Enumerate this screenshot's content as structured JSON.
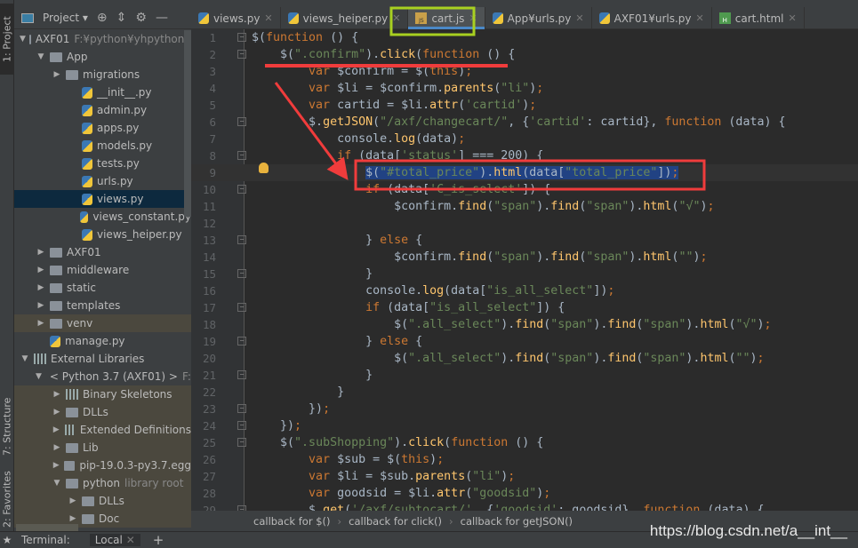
{
  "left_stripe": {
    "project": "1: Project",
    "structure": "7: Structure",
    "favorites": "2: Favorites"
  },
  "sidebar": {
    "title": "Project",
    "tree": [
      {
        "label": "AXF01",
        "extra": "F:¥python¥yhpython¥",
        "depth": 0,
        "arrow": "open",
        "icon": "folder"
      },
      {
        "label": "App",
        "depth": 1,
        "arrow": "open",
        "icon": "folder"
      },
      {
        "label": "migrations",
        "depth": 2,
        "arrow": "closed",
        "icon": "folder"
      },
      {
        "label": "__init__.py",
        "depth": 3,
        "icon": "python-file"
      },
      {
        "label": "admin.py",
        "depth": 3,
        "icon": "python-file"
      },
      {
        "label": "apps.py",
        "depth": 3,
        "icon": "python-file"
      },
      {
        "label": "models.py",
        "depth": 3,
        "icon": "python-file"
      },
      {
        "label": "tests.py",
        "depth": 3,
        "icon": "python-file"
      },
      {
        "label": "urls.py",
        "depth": 3,
        "icon": "python-file"
      },
      {
        "label": "views.py",
        "depth": 3,
        "icon": "python-file",
        "selected": true
      },
      {
        "label": "views_constant.py",
        "depth": 3,
        "icon": "python-file"
      },
      {
        "label": "views_heiper.py",
        "depth": 3,
        "icon": "python-file"
      },
      {
        "label": "AXF01",
        "depth": 1,
        "arrow": "closed",
        "icon": "folder"
      },
      {
        "label": "middleware",
        "depth": 1,
        "arrow": "closed",
        "icon": "folder"
      },
      {
        "label": "static",
        "depth": 1,
        "arrow": "closed",
        "icon": "folder"
      },
      {
        "label": "templates",
        "depth": 1,
        "arrow": "closed",
        "icon": "folder"
      },
      {
        "label": "venv",
        "depth": 1,
        "arrow": "closed",
        "icon": "folder",
        "lib": true
      },
      {
        "label": "manage.py",
        "depth": 1,
        "icon": "python-file"
      },
      {
        "label": "External Libraries",
        "depth": 0,
        "arrow": "open",
        "icon": "library"
      },
      {
        "label": "< Python 3.7 (AXF01) >",
        "extra": "F:¥",
        "depth": 1,
        "arrow": "open",
        "icon": "python-file"
      },
      {
        "label": "Binary Skeletons",
        "depth": 2,
        "arrow": "closed",
        "icon": "library",
        "lib": true
      },
      {
        "label": "DLLs",
        "depth": 2,
        "arrow": "closed",
        "icon": "folder",
        "lib": true
      },
      {
        "label": "Extended Definitions",
        "depth": 2,
        "arrow": "closed",
        "icon": "library",
        "lib": true
      },
      {
        "label": "Lib",
        "depth": 2,
        "arrow": "closed",
        "icon": "folder",
        "lib": true
      },
      {
        "label": "pip-19.0.3-py3.7.egg",
        "depth": 2,
        "arrow": "closed",
        "icon": "folder",
        "lib": true
      },
      {
        "label": "python",
        "extra": "library root",
        "depth": 2,
        "arrow": "open",
        "icon": "folder",
        "lib": true
      },
      {
        "label": "DLLs",
        "depth": 3,
        "arrow": "closed",
        "icon": "folder",
        "lib": true
      },
      {
        "label": "Doc",
        "depth": 3,
        "arrow": "closed",
        "icon": "folder",
        "lib": true
      }
    ]
  },
  "tabs": [
    {
      "label": "views.py",
      "icon": "python-file"
    },
    {
      "label": "views_heiper.py",
      "icon": "python-file"
    },
    {
      "label": "cart.js",
      "icon": "js-file",
      "active": true
    },
    {
      "label": "App¥urls.py",
      "icon": "python-file"
    },
    {
      "label": "AXF01¥urls.py",
      "icon": "python-file"
    },
    {
      "label": "cart.html",
      "icon": "html-file"
    }
  ],
  "editor": {
    "current_line": 9,
    "fold_lines": [
      1,
      2,
      6,
      8,
      10,
      13,
      15,
      17,
      19,
      21,
      23,
      24,
      25,
      29
    ],
    "lines": [
      "$(function () {",
      "    $(\".confirm\").click(function () {",
      "        var $confirm = $(this);",
      "        var $li = $confirm.parents(\"li\");",
      "        var cartid = $li.attr('cartid');",
      "        $.getJSON(\"/axf/changecart/\", {'cartid': cartid}, function (data) {",
      "            console.log(data);",
      "            if (data['status'] === 200) {",
      "                $(\"#total_price\").html(data[\"total_price\"]);",
      "                if (data['C_is_select']) {",
      "                    $confirm.find(\"span\").find(\"span\").html(\"√\");",
      "",
      "                } else {",
      "                    $confirm.find(\"span\").find(\"span\").html(\"\");",
      "                }",
      "                console.log(data[\"is_all_select\"]);",
      "                if (data[\"is_all_select\"]) {",
      "                    $(\".all_select\").find(\"span\").find(\"span\").html(\"√\");",
      "                } else {",
      "                    $(\".all_select\").find(\"span\").find(\"span\").html(\"\");",
      "                }",
      "            }",
      "        });",
      "    });",
      "    $(\".subShopping\").click(function () {",
      "        var $sub = $(this);",
      "        var $li = $sub.parents(\"li\");",
      "        var goodsid = $li.attr(\"goodsid\");",
      "        $.get('/axf/subtocart/', {'goodsid': goodsid}, function (data) {"
    ]
  },
  "breadcrumbs": [
    "callback for $()",
    "callback for click()",
    "callback for getJSON()"
  ],
  "bottom": {
    "terminal": "Terminal:",
    "local": "Local",
    "add": "+"
  },
  "watermark": "https://blog.csdn.net/a__int__",
  "colors": {
    "annotation_red": "#f03c3c",
    "annotation_green": "#a8d020",
    "keyword": "#cc7832",
    "string": "#6a8759",
    "function": "#ffc66d"
  }
}
